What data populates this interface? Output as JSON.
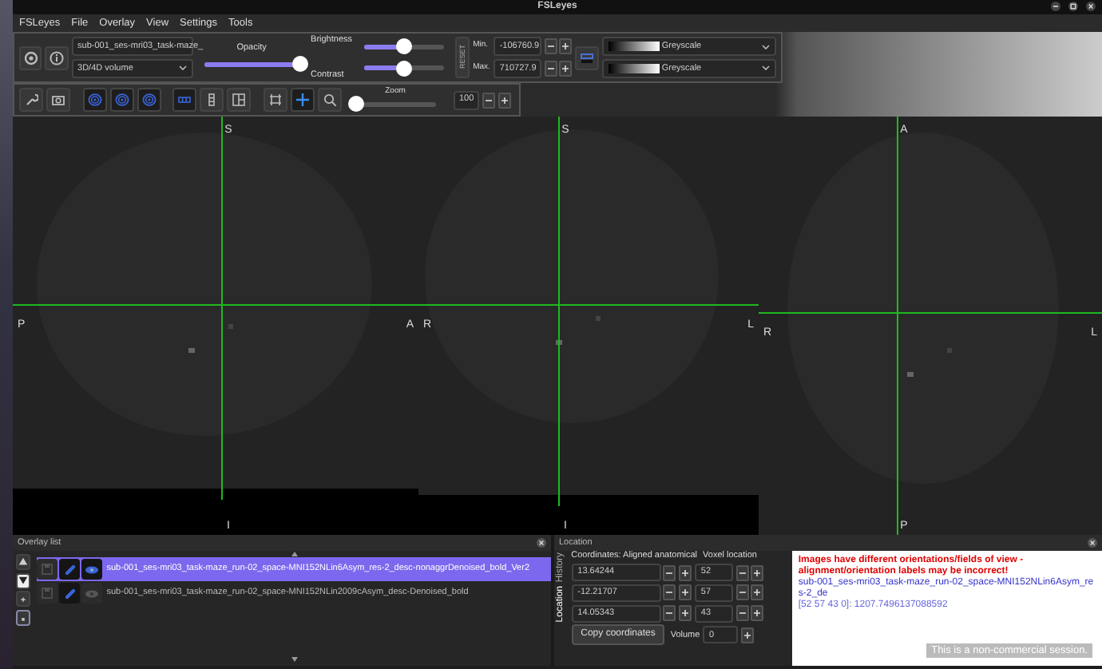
{
  "window": {
    "title": "FSLeyes"
  },
  "menu": [
    "FSLeyes",
    "File",
    "Overlay",
    "View",
    "Settings",
    "Tools"
  ],
  "overlay_toolbar": {
    "overlay_name": "sub-001_ses-mri03_task-maze_",
    "volume_type": "3D/4D volume",
    "opacity": {
      "label": "Opacity",
      "level": 1.0
    },
    "brightness": {
      "label": "Brightness",
      "level": 0.5
    },
    "contrast": {
      "label": "Contrast",
      "level": 0.5
    },
    "reset_label": "RESET",
    "min": {
      "label": "Min.",
      "value": "-106760.9"
    },
    "max": {
      "label": "Max.",
      "value": "710727.9"
    },
    "colormaps": [
      "Greyscale",
      "Greyscale"
    ]
  },
  "view_toolbar": {
    "view_toggles": [
      {
        "on": true
      },
      {
        "on": true
      },
      {
        "on": true
      }
    ],
    "layouts": [
      {
        "kind": "horizontal",
        "selected": true
      },
      {
        "kind": "vertical",
        "selected": false
      },
      {
        "kind": "grid",
        "selected": false
      }
    ],
    "crosshair_on": true,
    "zoom_label": "Zoom",
    "zoom": {
      "level": 0
    },
    "zoom_value": "100"
  },
  "views": [
    {
      "labels": {
        "top": "S",
        "left": "P",
        "right": "A",
        "bottom": "I"
      }
    },
    {
      "labels": {
        "top": "S",
        "left": "R",
        "right": "L",
        "bottom": "I"
      }
    },
    {
      "labels": {
        "top": "A",
        "left": "R",
        "right": "L",
        "bottom": "P"
      }
    }
  ],
  "overlay_list": {
    "title": "Overlay list",
    "overlays": [
      {
        "name": "sub-001_ses-mri03_task-maze_run-02_space-MNI152NLin6Asym_res-2_desc-nonaggrDenoised_bold_Ver2",
        "selected": true,
        "visible": true
      },
      {
        "name": "sub-001_ses-mri03_task-maze_run-02_space-MNI152NLin2009cAsym_desc-Denoised_bold",
        "selected": false,
        "visible": false
      }
    ]
  },
  "location": {
    "title": "Location",
    "side_tabs": [
      {
        "label": "Location",
        "selected": true
      },
      {
        "label": "History",
        "selected": false
      }
    ],
    "coord_header": "Coordinates: Aligned anatomical",
    "voxel_header": "Voxel location",
    "rows": [
      {
        "world": "13.64244",
        "voxel": "52"
      },
      {
        "world": "-12.21707",
        "voxel": "57"
      },
      {
        "world": "14.05343",
        "voxel": "43"
      }
    ],
    "copy_button": "Copy coordinates",
    "volume_label": "Volume",
    "volume_value": "0",
    "messages": [
      {
        "kind": "warning",
        "text": "Images have different orientations/fields of view - alignment/orientation labels may be incorrect!"
      },
      {
        "kind": "overlay",
        "text": "sub-001_ses-mri03_task-maze_run-02_space-MNI152NLin6Asym_res-2_de"
      },
      {
        "kind": "value",
        "text": "[52 57 43 0]: 1207.7496137088592"
      }
    ],
    "notice": "This is a non-commercial session."
  }
}
